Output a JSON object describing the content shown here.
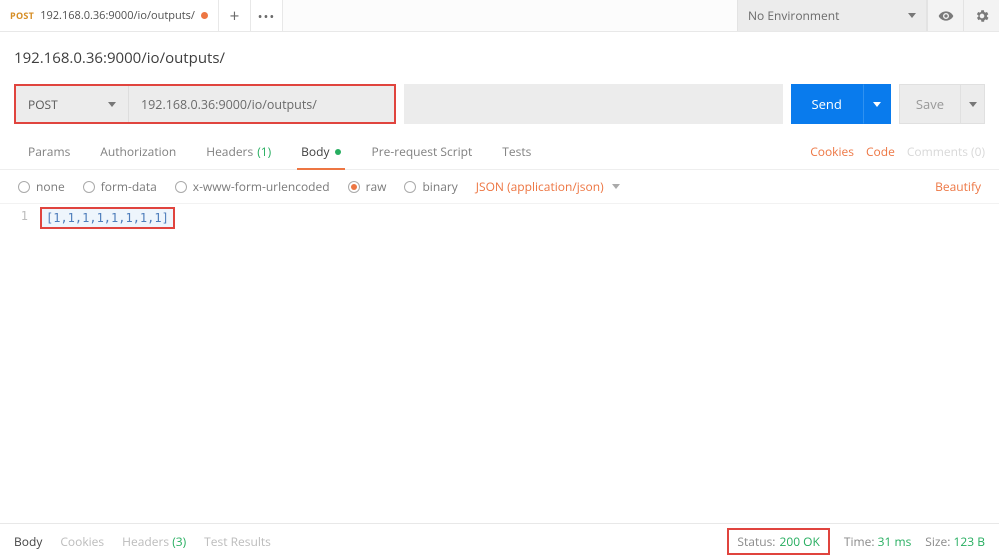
{
  "tab": {
    "method": "POST",
    "title": "192.168.0.36:9000/io/outputs/",
    "plus": "+",
    "dots": "•••"
  },
  "env": {
    "label": "No Environment"
  },
  "title": "192.168.0.36:9000/io/outputs/",
  "request": {
    "method": "POST",
    "url": "192.168.0.36:9000/io/outputs/",
    "send": "Send",
    "save": "Save"
  },
  "reqTabs": {
    "params": "Params",
    "authorization": "Authorization",
    "headers": "Headers",
    "headers_count": "(1)",
    "body": "Body",
    "prerequest": "Pre-request Script",
    "tests": "Tests"
  },
  "sideLinks": {
    "cookies": "Cookies",
    "code": "Code",
    "comments": "Comments (0)"
  },
  "bodyTypes": {
    "none": "none",
    "formdata": "form-data",
    "xwww": "x-www-form-urlencoded",
    "raw": "raw",
    "binary": "binary",
    "mime": "JSON (application/json)",
    "beautify": "Beautify"
  },
  "editor": {
    "line_no": "1",
    "line1": "[1,1,1,1,1,1,1,1]"
  },
  "respTabs": {
    "body": "Body",
    "cookies": "Cookies",
    "headers": "Headers",
    "headers_count": "(3)",
    "testresults": "Test Results"
  },
  "status": {
    "label": "Status:",
    "value": "200 OK",
    "time_label": "Time:",
    "time_value": "31 ms",
    "size_label": "Size:",
    "size_value": "123 B"
  }
}
